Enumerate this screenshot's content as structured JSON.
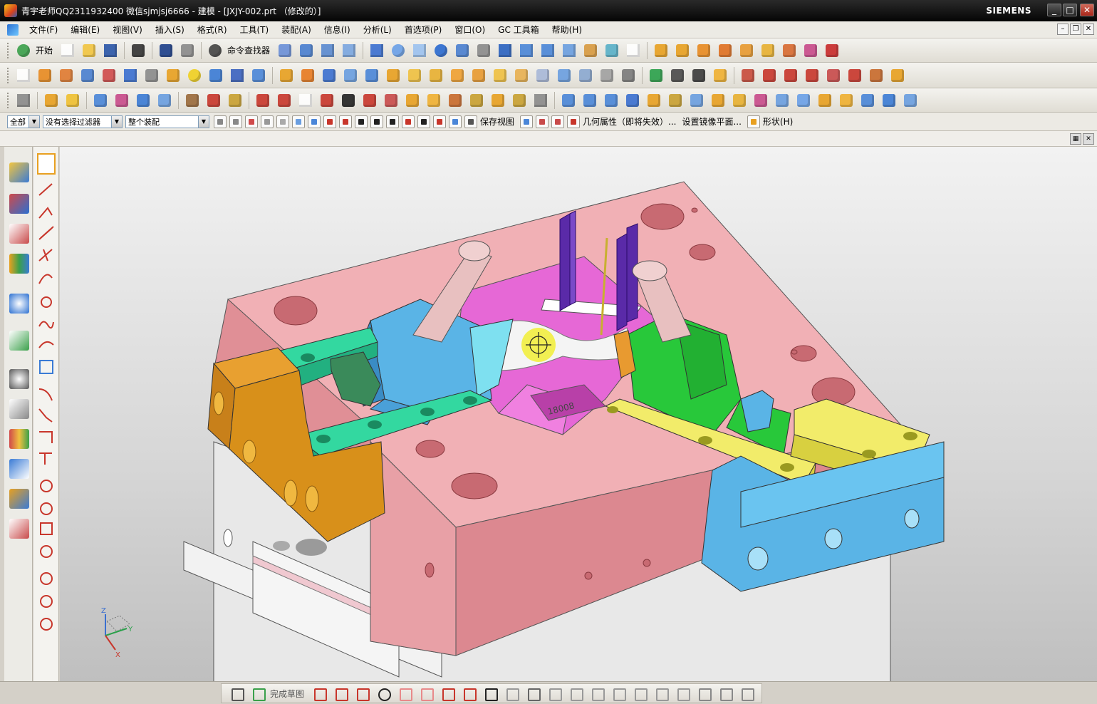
{
  "window": {
    "title": "青宇老师QQ2311932400 微信sjmjsj6666 - 建模 - [JXJY-002.prt （修改的）]",
    "brand": "SIEMENS",
    "buttons": [
      "_",
      "□",
      "✕"
    ]
  },
  "menubar": {
    "items": [
      "文件(F)",
      "编辑(E)",
      "视图(V)",
      "插入(S)",
      "格式(R)",
      "工具(T)",
      "装配(A)",
      "信息(I)",
      "分析(L)",
      "首选项(P)",
      "窗口(O)",
      "GC 工具箱",
      "帮助(H)"
    ]
  },
  "toolbar": {
    "start_label": "开始",
    "command_finder_label": "命令查找器"
  },
  "selection_bar": {
    "type_filter": "全部",
    "selection_filter": "没有选择过滤器",
    "assembly_scope": "整个装配",
    "save_view_label": "保存视图",
    "geom_props_label": "几何属性（即将失效）...",
    "mirror_plane_label": "设置镜像平面...",
    "shape_label": "形状(H)"
  },
  "bottom_toolbar": {
    "finish_sketch_label": "完成草图"
  },
  "viewport": {
    "part_label": "18008",
    "triad": {
      "z": "Z",
      "y": "Y",
      "x": "X"
    }
  },
  "colors": {
    "plate_pink": "#f1b0b5",
    "plate_pink_side": "#e08f96",
    "green_slider": "#28c83a",
    "blue_slider": "#5ab4e6",
    "yellow_rail": "#f2ec6a",
    "teal_rail": "#33d8a0",
    "orange_rail": "#d8901a",
    "magenta_insert": "#e668d6",
    "purple_pins": "#5a2aa8"
  }
}
